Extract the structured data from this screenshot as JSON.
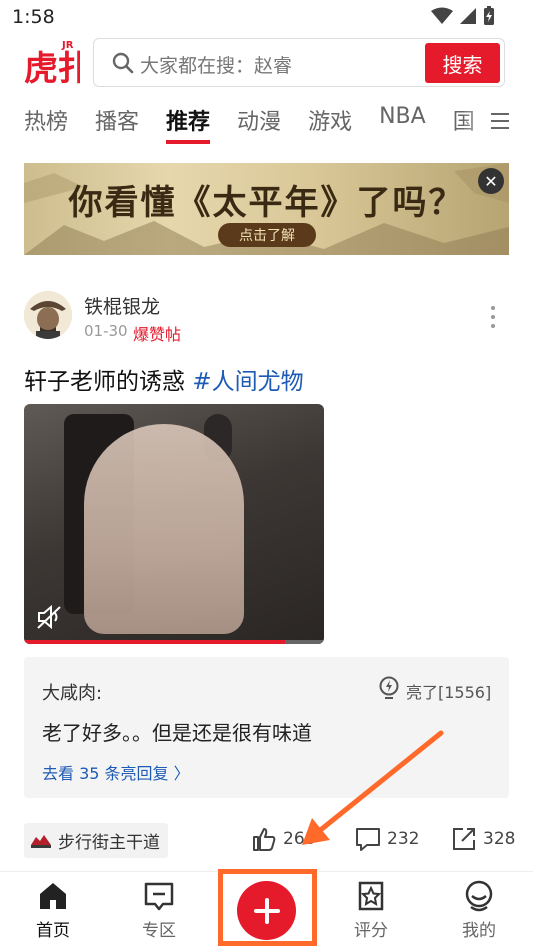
{
  "status_bar": {
    "time": "1:58"
  },
  "header": {
    "logo_text": "虎扑",
    "logo_badge": "JR",
    "search": {
      "placeholder": "大家都在搜：赵睿",
      "button_label": "搜索"
    }
  },
  "tabs": [
    {
      "label": "热榜",
      "active": false
    },
    {
      "label": "播客",
      "active": false
    },
    {
      "label": "推荐",
      "active": true
    },
    {
      "label": "动漫",
      "active": false
    },
    {
      "label": "游戏",
      "active": false
    },
    {
      "label": "NBA",
      "active": false
    },
    {
      "label": "国",
      "active": false
    }
  ],
  "banner": {
    "title": "你看懂《太平年》了吗？",
    "cta": "点击了解"
  },
  "post": {
    "author": "铁棍银龙",
    "date": "01-30",
    "badge": "爆赞帖",
    "title": "轩子老师的诱惑",
    "hashtag": "#人间尤物",
    "video_progress": 0.87,
    "top_comment": {
      "author": "大咸肉:",
      "light_label": "亮了[1556]",
      "text": "老了好多。。但是还是很有味道",
      "replies_link": "去看 35 条亮回复 〉"
    },
    "board": "步行街主干道",
    "likes": "268",
    "comments": "232",
    "shares": "328"
  },
  "bottom_nav": [
    {
      "label": "首页",
      "icon": "home-icon",
      "active": true
    },
    {
      "label": "专区",
      "icon": "zone-icon",
      "active": false
    },
    {
      "label": "",
      "icon": "publish-plus-icon",
      "active": false
    },
    {
      "label": "评分",
      "icon": "rating-star-icon",
      "active": false
    },
    {
      "label": "我的",
      "icon": "profile-icon",
      "active": false
    }
  ],
  "colors": {
    "brand_red": "#e51a2b",
    "link_blue": "#1e5bb5",
    "annotation_orange": "#ff6a2b"
  }
}
